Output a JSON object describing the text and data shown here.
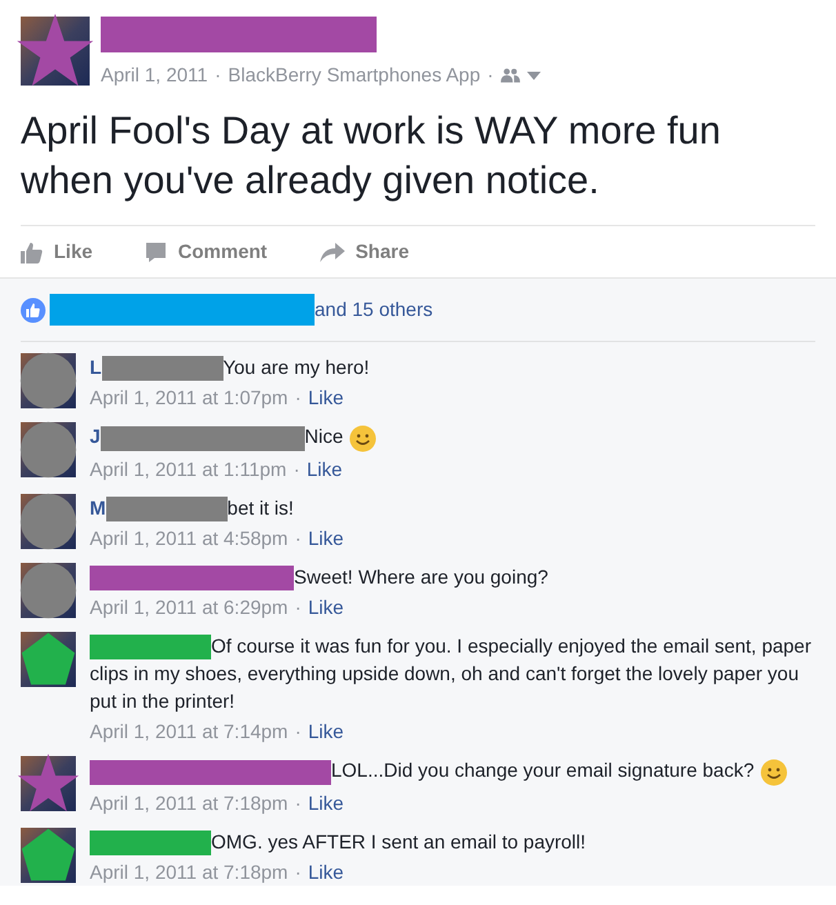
{
  "post": {
    "avatar": {
      "kind": "star",
      "color": "#a349a4"
    },
    "name_redaction": {
      "color": "#a349a4"
    },
    "date": "April 1, 2011",
    "source": "BlackBerry Smartphones App",
    "separator": "·",
    "text": "April Fool's Day at work is WAY more fun when you've already given notice."
  },
  "actions": [
    {
      "kind": "like",
      "label": "Like"
    },
    {
      "kind": "comment",
      "label": "Comment"
    },
    {
      "kind": "share",
      "label": "Share"
    }
  ],
  "likes": {
    "redaction": {
      "color": "#00a2e8"
    },
    "text": "and 15 others"
  },
  "comments": [
    {
      "avatar": {
        "kind": "circle",
        "color": "#7f7f7f"
      },
      "initial": "L",
      "redaction": {
        "color": "#7f7f7f"
      },
      "text": "You are my hero!",
      "smiley": false,
      "time": "April 1, 2011 at 1:07pm",
      "like": "Like"
    },
    {
      "avatar": {
        "kind": "circle",
        "color": "#7f7f7f"
      },
      "initial": "J",
      "redaction": {
        "color": "#7f7f7f"
      },
      "text": "Nice",
      "smiley": true,
      "time": "April 1, 2011 at 1:11pm",
      "like": "Like"
    },
    {
      "avatar": {
        "kind": "circle",
        "color": "#7f7f7f"
      },
      "initial": "M",
      "redaction": {
        "color": "#7f7f7f"
      },
      "text": "bet it is!",
      "smiley": false,
      "time": "April 1, 2011 at 4:58pm",
      "like": "Like"
    },
    {
      "avatar": {
        "kind": "circle",
        "color": "#7f7f7f"
      },
      "redaction": {
        "color": "#a349a4"
      },
      "text": "Sweet! Where are you going?",
      "smiley": false,
      "time": "April 1, 2011 at 6:29pm",
      "like": "Like"
    },
    {
      "avatar": {
        "kind": "pentagon",
        "color": "#22b14c"
      },
      "redaction": {
        "color": "#22b14c"
      },
      "text": "Of course it was fun for you. I especially enjoyed the email sent, paper clips in my shoes, everything upside down, oh and can't forget the lovely paper you put in the printer!",
      "smiley": false,
      "time": "April 1, 2011 at 7:14pm",
      "like": "Like"
    },
    {
      "avatar": {
        "kind": "star",
        "color": "#a349a4"
      },
      "redaction": {
        "color": "#a349a4"
      },
      "text": "LOL...Did you change your email signature back?",
      "smiley": true,
      "time": "April 1, 2011 at 7:18pm",
      "like": "Like"
    },
    {
      "avatar": {
        "kind": "pentagon",
        "color": "#22b14c"
      },
      "redaction": {
        "color": "#22b14c"
      },
      "text": "OMG. yes AFTER I sent an email to payroll!",
      "smiley": false,
      "time": "April 1, 2011 at 7:18pm",
      "like": "Like"
    }
  ]
}
